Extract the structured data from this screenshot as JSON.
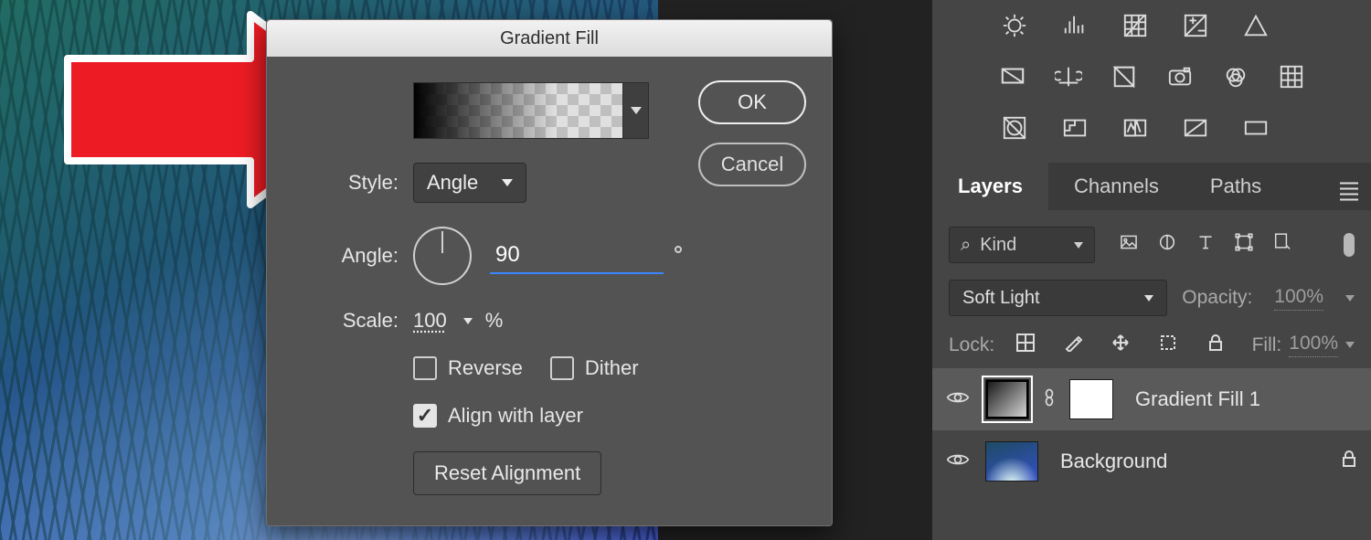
{
  "dialog": {
    "title": "Gradient Fill",
    "ok": "OK",
    "cancel": "Cancel",
    "style_label": "Style:",
    "style_value": "Angle",
    "angle_label": "Angle:",
    "angle_value": "90",
    "scale_label": "Scale:",
    "scale_value": "100",
    "scale_unit": "%",
    "reverse_label": "Reverse",
    "dither_label": "Dither",
    "align_label": "Align with layer",
    "align_checked": true,
    "reset_btn": "Reset Alignment"
  },
  "panels": {
    "tabs": {
      "layers": "Layers",
      "channels": "Channels",
      "paths": "Paths"
    },
    "filter_kind": "Kind",
    "blend_mode": "Soft Light",
    "opacity_label": "Opacity:",
    "opacity_value": "100%",
    "lock_label": "Lock:",
    "fill_label": "Fill:",
    "fill_value": "100%",
    "layer1_name": "Gradient Fill 1",
    "layer2_name": "Background"
  },
  "icons": {
    "search": "⌕"
  }
}
